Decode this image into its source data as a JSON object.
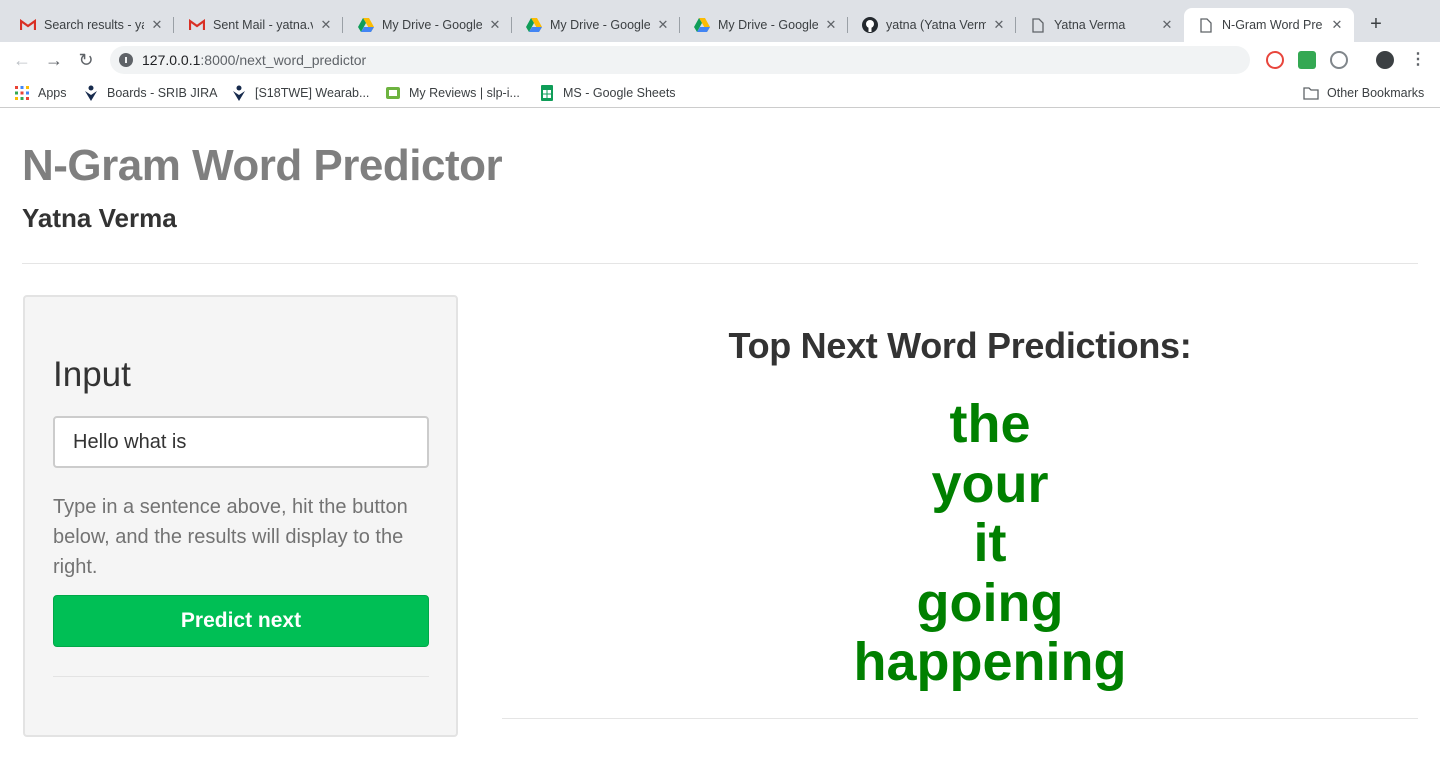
{
  "browser": {
    "tabs": [
      {
        "title": "Search results - ya",
        "icon": "gmail-icon"
      },
      {
        "title": "Sent Mail - yatna.v",
        "icon": "gmail-icon"
      },
      {
        "title": "My Drive - Google",
        "icon": "google-drive-icon"
      },
      {
        "title": "My Drive - Google",
        "icon": "google-drive-icon"
      },
      {
        "title": "My Drive - Google",
        "icon": "google-drive-icon"
      },
      {
        "title": "yatna (Yatna Verm",
        "icon": "github-icon"
      },
      {
        "title": "Yatna Verma",
        "icon": "document-icon"
      },
      {
        "title": "N-Gram Word Pre",
        "icon": "document-icon",
        "active": true
      }
    ],
    "url_host": "127.0.0.1",
    "url_rest": ":8000/next_word_predictor",
    "bookmarks": [
      {
        "label": "Apps",
        "icon": "apps-grid-icon"
      },
      {
        "label": "Boards - SRIB JIRA",
        "icon": "jira-icon"
      },
      {
        "label": "[S18TWE] Wearab...",
        "icon": "jira-icon"
      },
      {
        "label": "My Reviews | slp-i...",
        "icon": "review-icon"
      },
      {
        "label": "MS - Google Sheets",
        "icon": "google-sheets-icon"
      }
    ],
    "other_bookmarks": "Other Bookmarks"
  },
  "page": {
    "title": "N-Gram Word Predictor",
    "subtitle": "Yatna Verma",
    "input_panel": {
      "heading": "Input",
      "input_value": "Hello what is",
      "help_text": "Type in a sentence above, hit the button below, and the results will display to the right.",
      "button_label": "Predict next"
    },
    "predictions": {
      "heading": "Top Next Word Predictions:",
      "words": [
        "the",
        "your",
        "it",
        "going",
        "happening"
      ]
    }
  },
  "colors": {
    "prediction_green": "#008000",
    "button_green": "#00bf55",
    "title_gray": "#7f7f7f"
  }
}
